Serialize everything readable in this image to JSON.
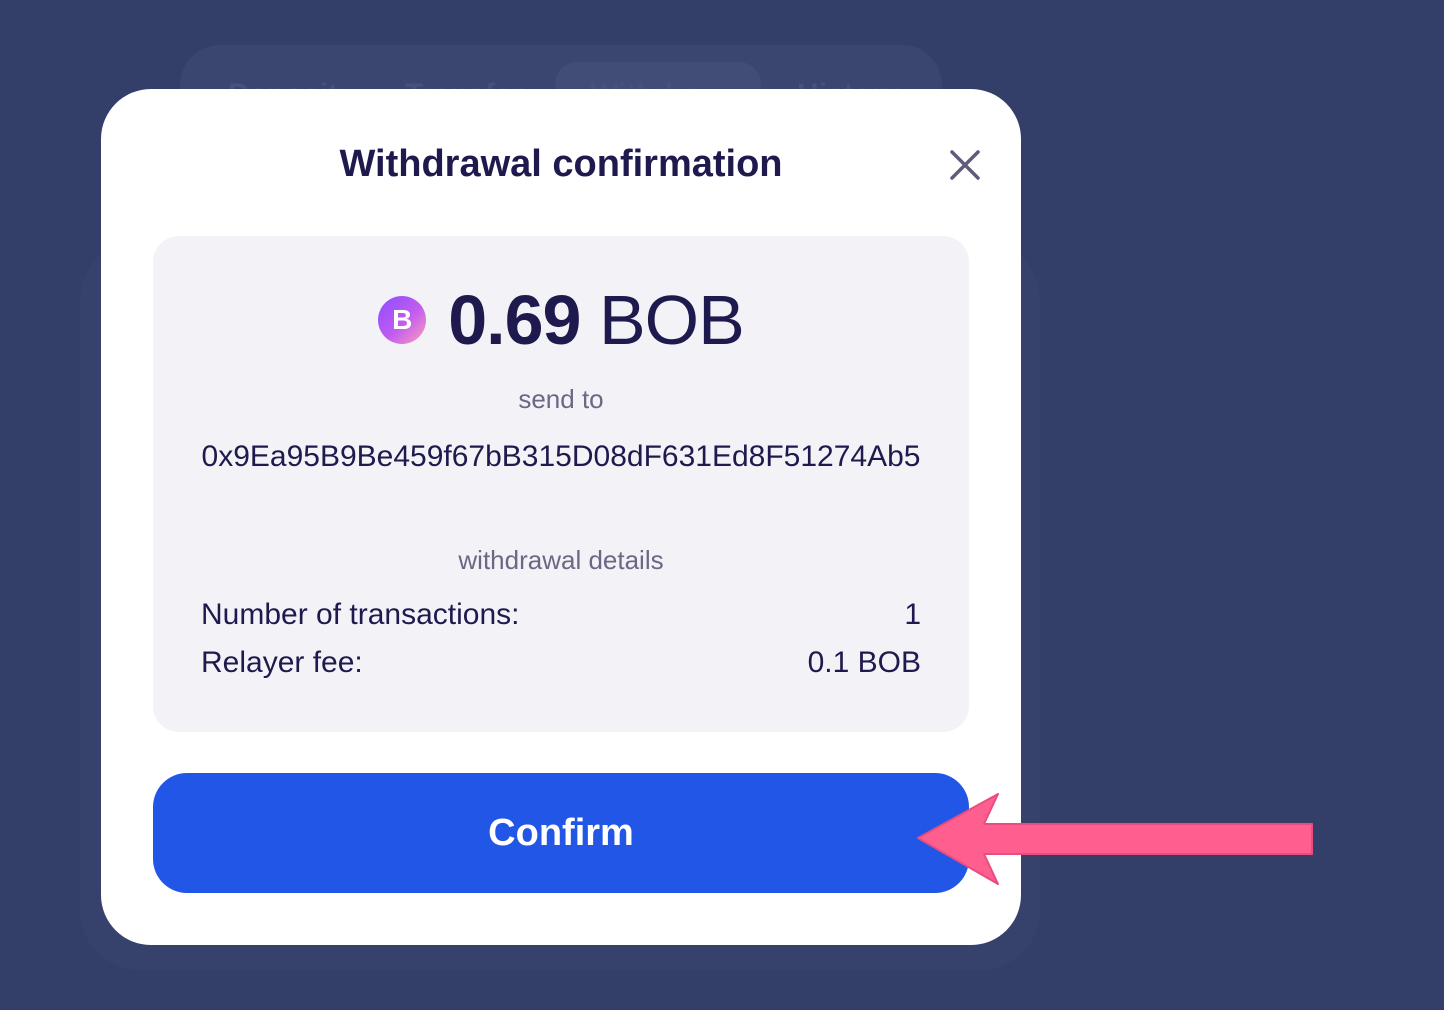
{
  "background": {
    "tabs": [
      "Deposit",
      "Transfer",
      "Withdraw",
      "History"
    ]
  },
  "modal": {
    "title": "Withdrawal confirmation",
    "amount": "0.69",
    "amount_unit": "BOB",
    "token_icon_letter": "B",
    "send_to_label": "send to",
    "address": "0x9Ea95B9Be459f67bB315D08dF631Ed8F51274Ab5",
    "details_label": "withdrawal details",
    "details": [
      {
        "label": "Number of transactions:",
        "value": "1"
      },
      {
        "label": "Relayer fee:",
        "value": "0.1 BOB"
      }
    ],
    "confirm_label": "Confirm"
  },
  "colors": {
    "backdrop": "#343f69",
    "primary_button": "#2256e6",
    "annotation_arrow": "#ff5f8f",
    "text_dark": "#1f1a4d"
  },
  "icons": {
    "close": "close-icon",
    "token": "bob-token-icon",
    "annotation": "annotation-arrow-icon"
  }
}
